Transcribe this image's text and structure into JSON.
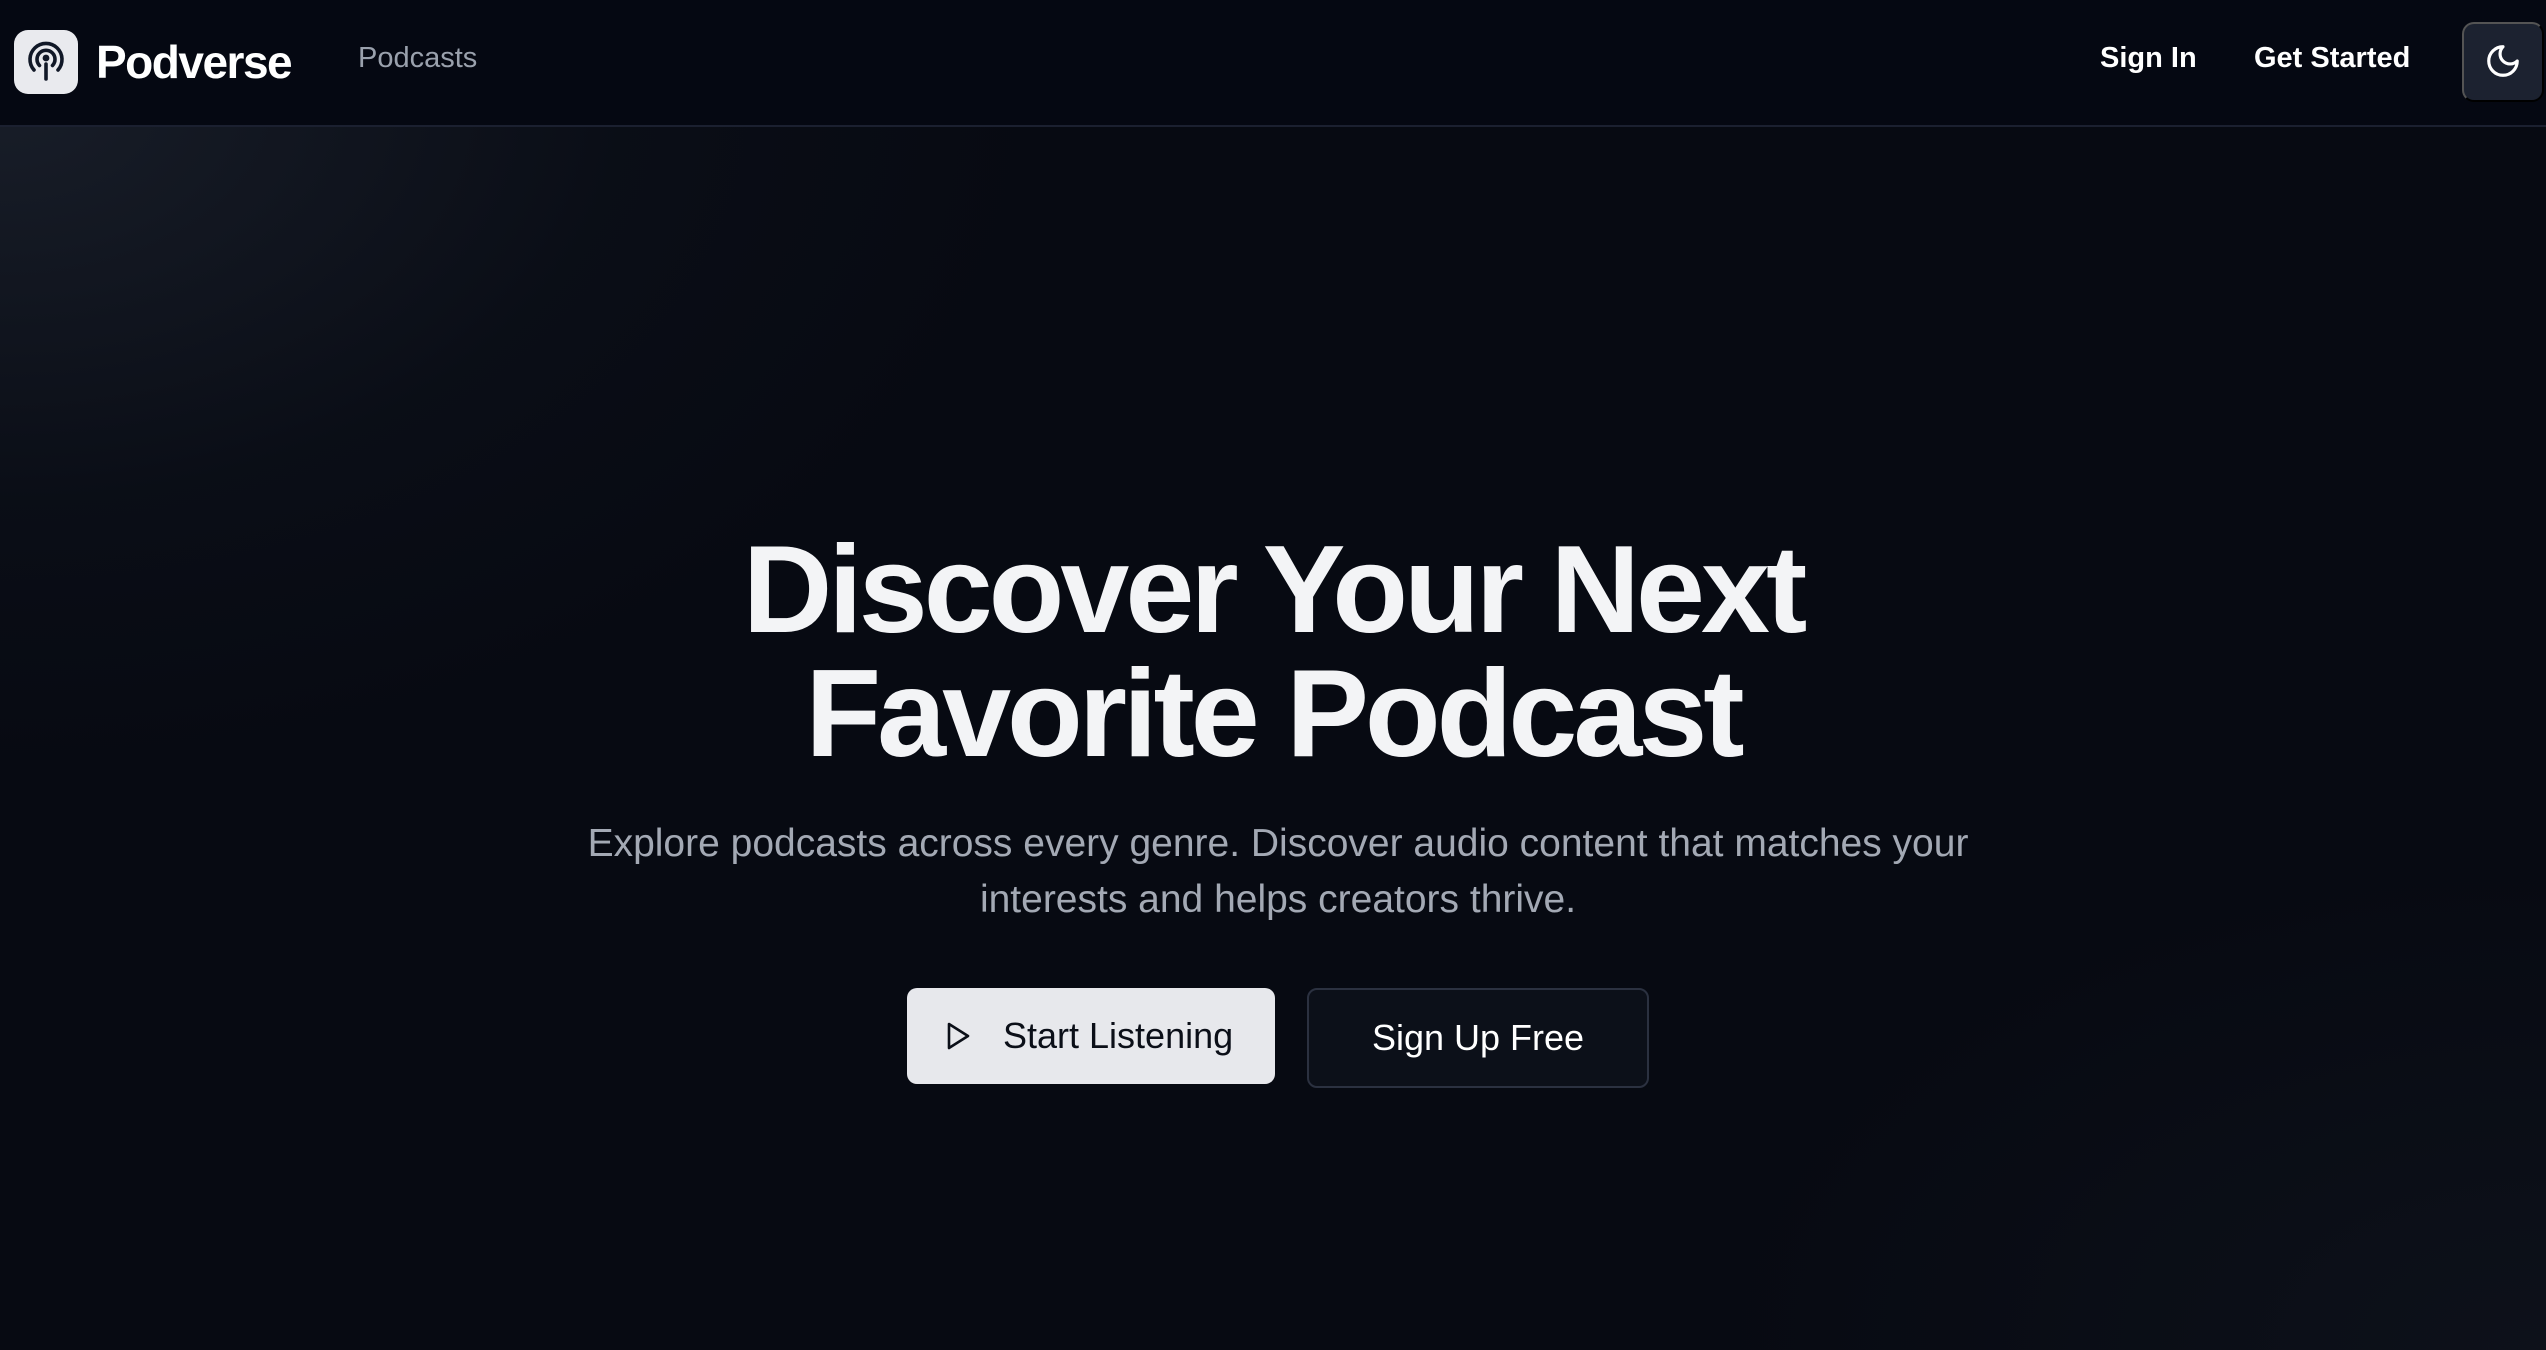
{
  "navbar": {
    "brand_name": "Podverse",
    "brand_icon": "podcast-icon",
    "links": {
      "podcasts": "Podcasts"
    },
    "actions": {
      "sign_in": "Sign In",
      "get_started": "Get Started",
      "theme_toggle_icon": "moon-icon"
    }
  },
  "hero": {
    "title_line1": "Discover Your Next",
    "title_line2": "Favorite Podcast",
    "subtitle": "Explore podcasts across every genre. Discover audio content that matches your interests and helps creators thrive.",
    "primary_button": {
      "label": "Start Listening",
      "icon": "play-icon"
    },
    "secondary_button": {
      "label": "Sign Up Free"
    }
  },
  "colors": {
    "background": "#070a12",
    "navbar_bg": "#050812",
    "primary_button_bg": "#e7e8ec",
    "secondary_button_bg": "#0c1019",
    "muted_text": "#a3a9b4"
  }
}
